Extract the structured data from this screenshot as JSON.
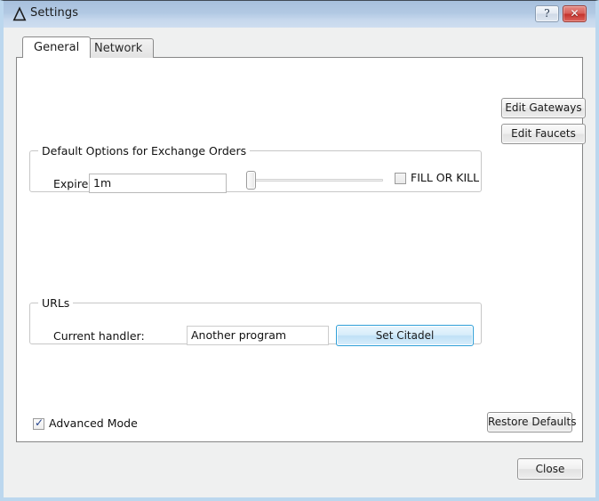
{
  "window": {
    "title": "Settings",
    "icon": "delta-icon",
    "help_button_label": "?",
    "close_button_label": "✕"
  },
  "tabs": [
    {
      "label": "General",
      "active": true
    },
    {
      "label": "Network",
      "active": false
    }
  ],
  "general_tab": {
    "top_buttons": [
      {
        "label": "Edit Gateways",
        "name": "edit-gateways-button"
      },
      {
        "label": "Edit Faucets",
        "name": "edit-faucets-button"
      }
    ],
    "exchange_orders": {
      "group_title": "Default Options for Exchange Orders",
      "expire_in_label": "Expire In",
      "expire_in_value": "1m",
      "expire_in_placeholder": "",
      "slider": {
        "value": 0,
        "min": 0,
        "max": 100,
        "position": "left"
      },
      "fill_or_kill_label": "FILL OR KILL",
      "fill_or_kill_checked": false
    },
    "urls": {
      "group_title": "URLs",
      "current_handler_label": "Current handler:",
      "current_handler_value": "Another program",
      "set_citadel_label": "Set Citadel"
    },
    "advanced_mode_label": "Advanced Mode",
    "advanced_mode_checked": true,
    "advanced_mode_mark": "✓",
    "restore_defaults_label": "Restore Defaults"
  },
  "footer": {
    "close_label": "Close"
  },
  "colors": {
    "titlebar_top": "#a7c0dd",
    "titlebar_bottom": "#cfdef0",
    "frame": "#bcd7ee",
    "dialog_bg": "#eff0f0",
    "panel_bg": "#ffffff",
    "accent_button_border": "#2f9fd8",
    "close_button_red": "#c4332d",
    "checkmark": "#21418c"
  }
}
